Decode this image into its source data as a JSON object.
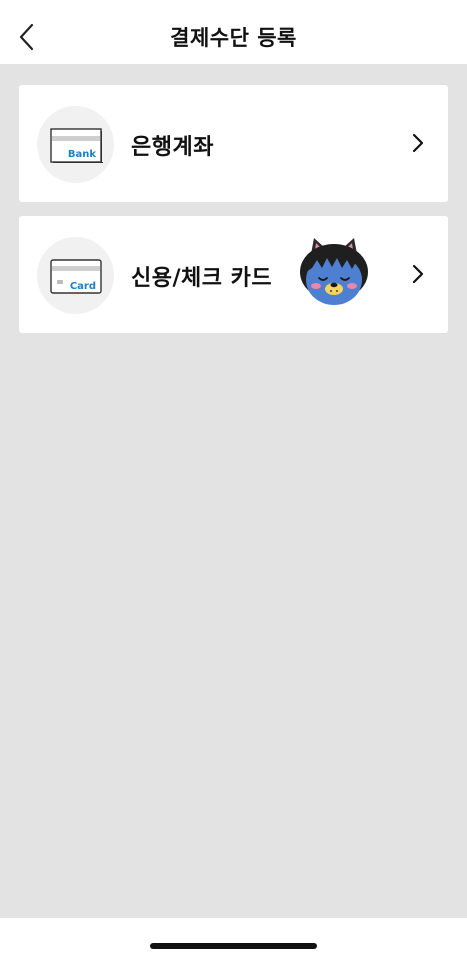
{
  "header": {
    "title": "결제수단 등록",
    "back_icon": "chevron-left-icon"
  },
  "methods": [
    {
      "label": "은행계좌",
      "icon": "bank-card-icon",
      "icon_text": "Bank",
      "chevron": "chevron-right-icon"
    },
    {
      "label": "신용/체크 카드",
      "icon": "credit-card-icon",
      "icon_text": "Card",
      "chevron": "chevron-right-icon",
      "mascot": "sleeping-cat-character"
    }
  ],
  "colors": {
    "background": "#e3e3e3",
    "card": "#ffffff",
    "icon_circle": "#f1f1f1",
    "accent_blue": "#1f7fc4",
    "text": "#111111"
  }
}
